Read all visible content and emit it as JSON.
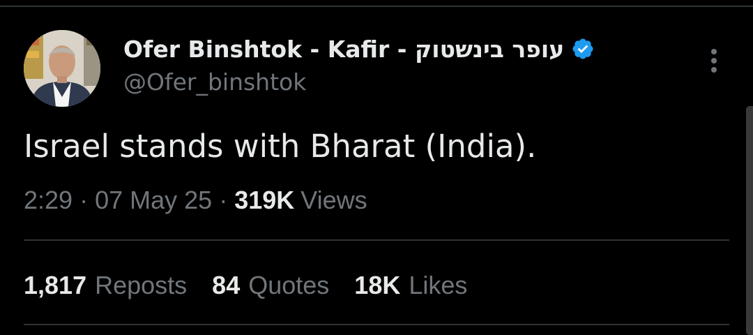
{
  "tweet": {
    "author": {
      "display_name": "Ofer Binshtok - Kafir - עופר בינשטוק",
      "handle": "@Ofer_binshtok",
      "verified": true,
      "avatar_icon": "profile-photo"
    },
    "text": "Israel stands with Bharat (India).",
    "meta": {
      "time": "2:29",
      "separator": "·",
      "date": "07 May 25",
      "views_count": "319K",
      "views_label": "Views"
    },
    "stats": [
      {
        "count": "1,817",
        "label": "Reposts"
      },
      {
        "count": "84",
        "label": "Quotes"
      },
      {
        "count": "18K",
        "label": "Likes"
      }
    ],
    "more_icon": "more-vertical-icon"
  },
  "colors": {
    "background": "#000000",
    "primary_text": "#e7e9ea",
    "secondary_text": "#71767b",
    "divider": "#2f3336",
    "verified_blue": "#1d9bf0"
  }
}
